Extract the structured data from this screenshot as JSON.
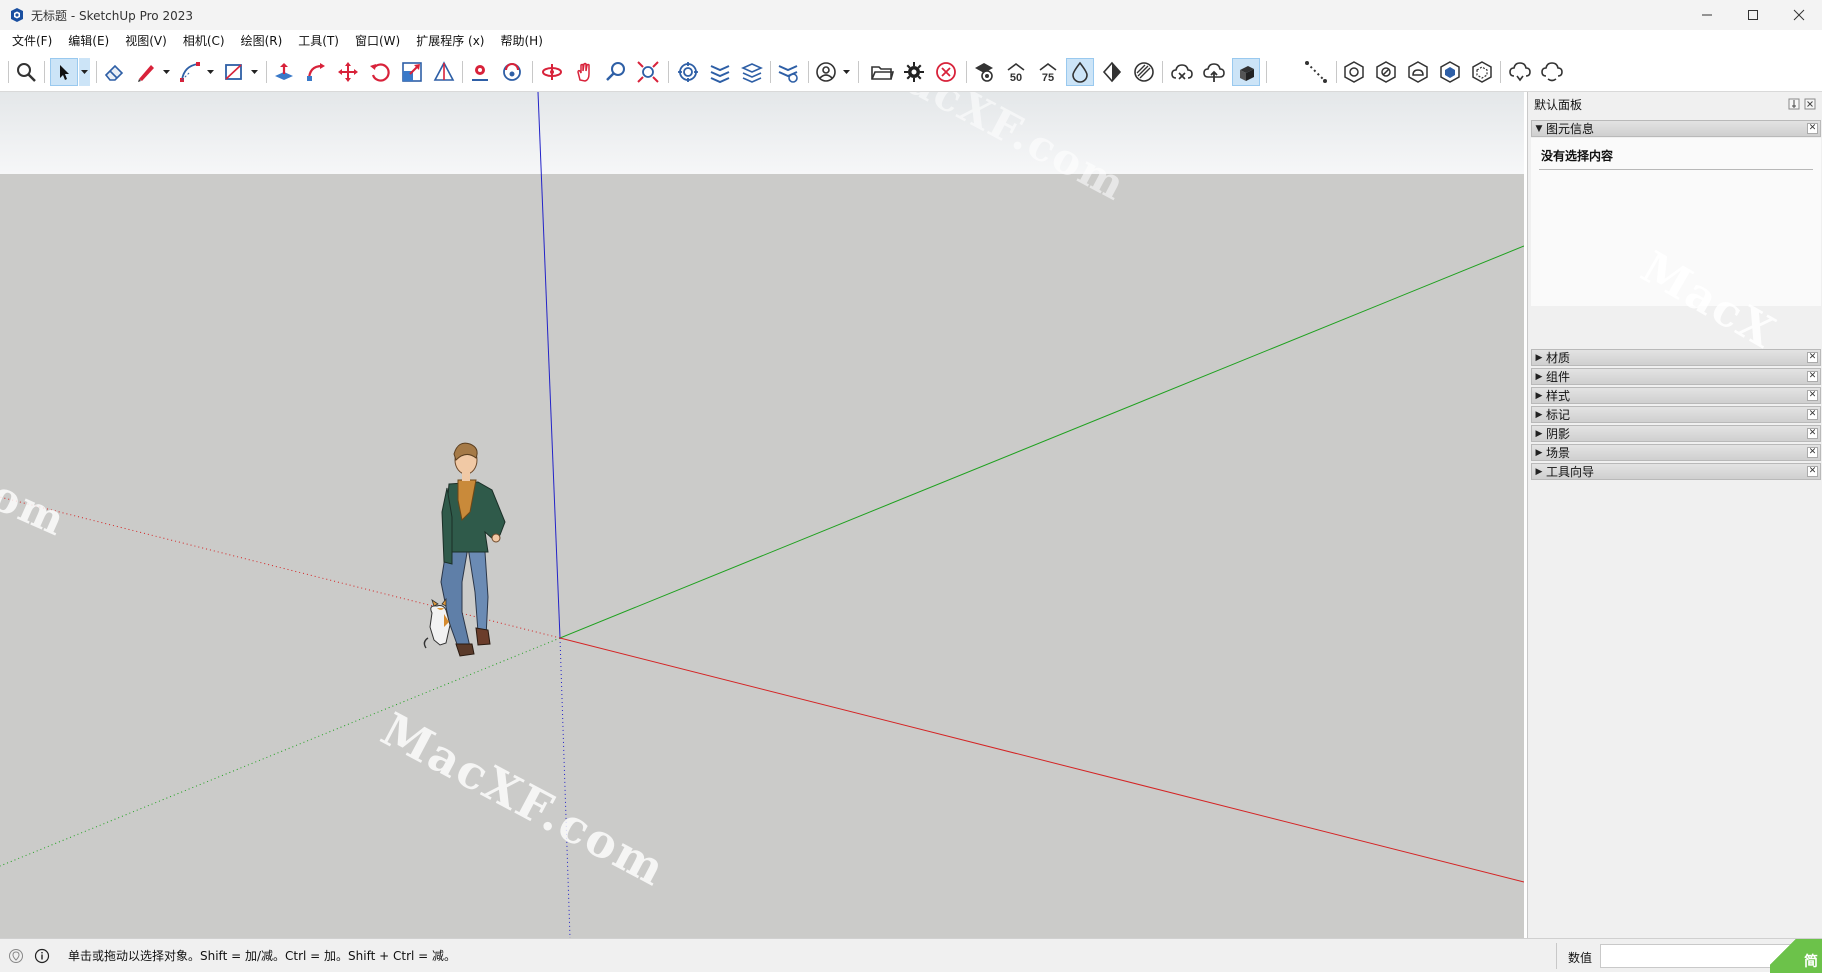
{
  "window": {
    "title": "无标题 - SketchUp Pro 2023"
  },
  "menu": [
    "文件(F)",
    "编辑(E)",
    "视图(V)",
    "相机(C)",
    "绘图(R)",
    "工具(T)",
    "窗口(W)",
    "扩展程序 (x)",
    "帮助(H)"
  ],
  "toolbar_icons": [
    "zoom-icon",
    "select-icon",
    "eraser-icon",
    "pencil-line-icon",
    "arc-icon",
    "rectangle-icon",
    "push-pull-icon",
    "follow-me-icon",
    "move-icon",
    "rotate-icon",
    "scale-icon",
    "protractor-icon",
    "position-camera-icon",
    "look-around-icon",
    "orbit-icon",
    "pan-icon",
    "zoom-window-icon",
    "zoom-extents-icon",
    "sandbox-icon",
    "layers-icon",
    "stack-icon",
    "settings-stack-icon",
    "user-icon",
    "open-folder-icon",
    "gear-icon",
    "close-circle-icon",
    "eye-icon",
    "fifty-icon",
    "seventy-five-icon",
    "drop-icon",
    "leaf-icon",
    "hatch-icon",
    "cloud-x-icon",
    "cloud-upload-icon",
    "cloud-cube-icon",
    "dotted-line-icon",
    "iso-view-icon",
    "top-view-icon",
    "front-view-icon",
    "right-view-icon",
    "back-view-icon",
    "cloud-sync-icon",
    "cloud-refresh-icon"
  ],
  "panel": {
    "title": "默认面板",
    "entity_info": {
      "label": "图元信息",
      "empty_text": "没有选择内容"
    },
    "trays": [
      "材质",
      "组件",
      "样式",
      "标记",
      "阴影",
      "场景",
      "工具向导"
    ]
  },
  "status": {
    "hint": "单击或拖动以选择对象。Shift = 加/减。Ctrl = 加。Shift + Ctrl = 减。",
    "measurements_label": "数值",
    "measurements_value": ""
  },
  "watermark": {
    "text_main": "MacXF.com",
    "text_corner": "MacX",
    "text_left": "om",
    "badge": "简"
  },
  "colors": {
    "sky_top": "#dfe3e5",
    "ground": "#cbcbc9",
    "axis_red": "#d42424",
    "axis_green": "#1fa11f",
    "axis_blue": "#2323c8"
  }
}
